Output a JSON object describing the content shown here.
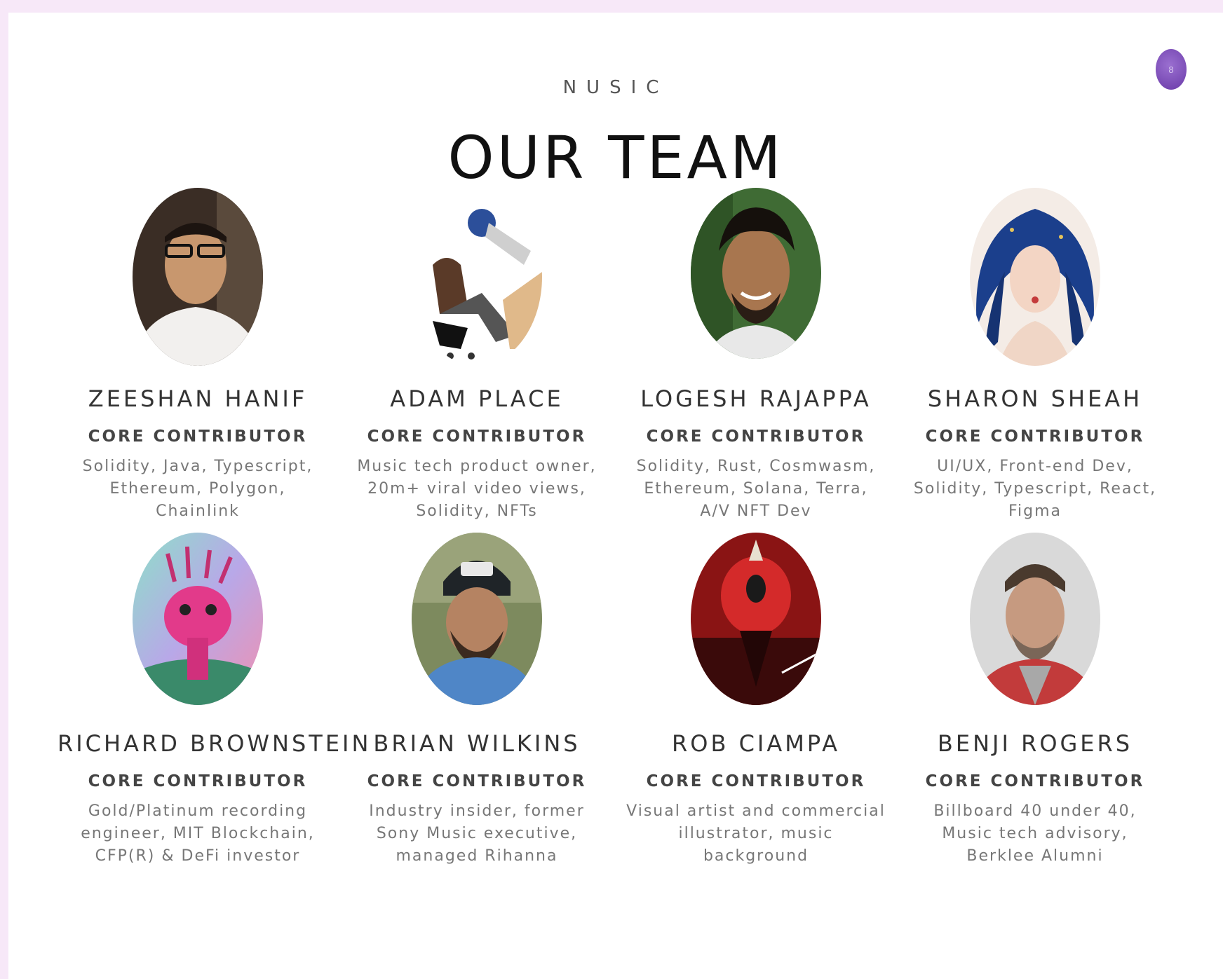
{
  "header": {
    "brand": "NUSIC",
    "title": "OUR TEAM",
    "avatar_initial": "8"
  },
  "team": [
    {
      "name": "ZEESHAN HANIF",
      "role": "CORE CONTRIBUTOR",
      "bio": "Solidity, Java, Typescript, Ethereum, Polygon, Chainlink"
    },
    {
      "name": "ADAM PLACE",
      "role": "CORE CONTRIBUTOR",
      "bio": "Music tech product owner, 20m+ viral video views, Solidity, NFTs"
    },
    {
      "name": "LOGESH RAJAPPA",
      "role": "CORE CONTRIBUTOR",
      "bio": "Solidity, Rust, Cosmwasm, Ethereum, Solana, Terra, A/V NFT Dev"
    },
    {
      "name": "SHARON SHEAH",
      "role": "CORE CONTRIBUTOR",
      "bio": "UI/UX, Front-end Dev, Solidity, Typescript, React, Figma"
    },
    {
      "name": "RICHARD BROWNSTEIN",
      "role": "CORE CONTRIBUTOR",
      "bio": "Gold/Platinum recording engineer, MIT Blockchain, CFP(R) & DeFi investor"
    },
    {
      "name": "BRIAN WILKINS",
      "role": "CORE CONTRIBUTOR",
      "bio": "Industry insider, former Sony Music executive, managed Rihanna"
    },
    {
      "name": "ROB CIAMPA",
      "role": "CORE CONTRIBUTOR",
      "bio": "Visual artist and commercial illustrator, music background"
    },
    {
      "name": "BENJI ROGERS",
      "role": "CORE CONTRIBUTOR",
      "bio": "Billboard 40 under 40, Music tech advisory, Berklee Alumni"
    }
  ]
}
